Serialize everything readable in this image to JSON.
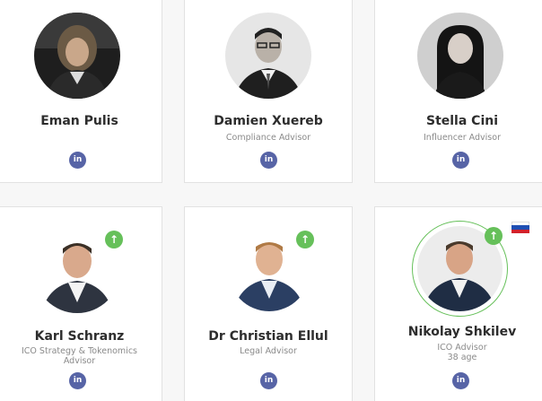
{
  "team": [
    {
      "name": "Eman Pulis",
      "role": "",
      "social": "in"
    },
    {
      "name": "Damien Xuereb",
      "role": "Compliance Advisor",
      "social": "in"
    },
    {
      "name": "Stella Cini",
      "role": "Influencer Advisor",
      "social": "in"
    },
    {
      "name": "Karl Schranz",
      "role": "ICO Strategy & Tokenomics Advisor",
      "social": "in"
    },
    {
      "name": "Dr Christian Ellul",
      "role": "Legal Advisor",
      "social": "in"
    },
    {
      "name": "Nikolay Shkilev",
      "role": "ICO Advisor",
      "age": "38 age",
      "social": "in"
    }
  ],
  "icons": {
    "linkedin": "linkedin-icon",
    "up": "arrow-up-icon",
    "flag": "russia-flag-icon"
  },
  "colors": {
    "linkedin": "#5764a6",
    "badge_green": "#66c05a",
    "name_text": "#2d2d2d",
    "role_text": "#8a8a8a"
  }
}
